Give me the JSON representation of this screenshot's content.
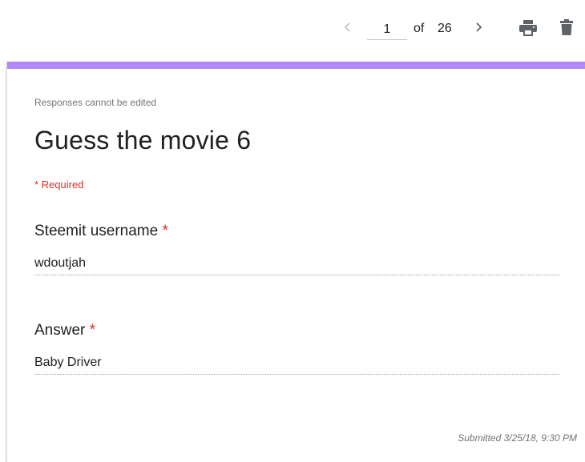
{
  "toolbar": {
    "current_page": "1",
    "of_label": "of",
    "total_pages": "26",
    "prev_icon": "chevron-left-icon",
    "next_icon": "chevron-right-icon",
    "print_icon": "print-icon",
    "delete_icon": "trash-icon"
  },
  "form": {
    "accent_color": "#b388ff",
    "notice": "Responses cannot be edited",
    "title": "Guess the movie 6",
    "required_note": "* Required",
    "questions": [
      {
        "label": "Steemit username",
        "required_mark": "*",
        "answer": "wdoutjah"
      },
      {
        "label": "Answer",
        "required_mark": "*",
        "answer": "Baby Driver"
      }
    ],
    "submitted": "Submitted 3/25/18, 9:30 PM"
  }
}
